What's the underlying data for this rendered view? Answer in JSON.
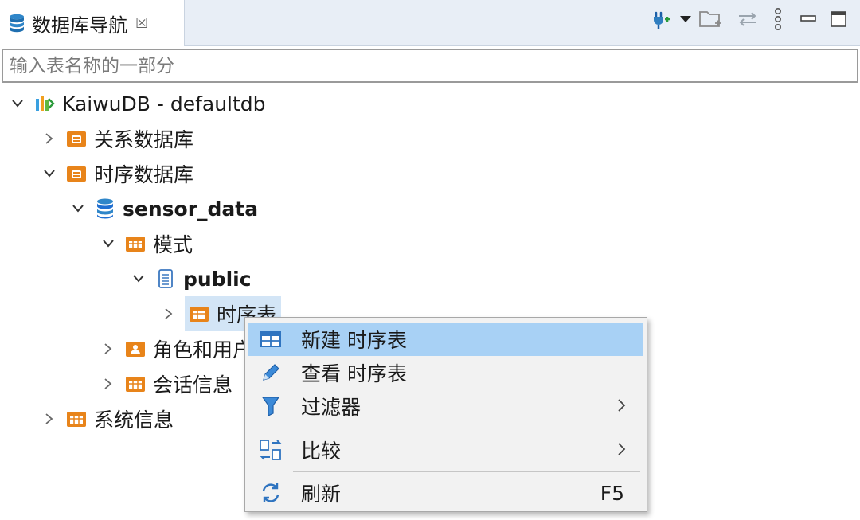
{
  "tab": {
    "title": "数据库导航",
    "close_symbol": "☒"
  },
  "toolbar": {
    "items": [
      "connect-icon",
      "dropdown-arrow-icon",
      "new-folder-icon",
      "link-editor-icon",
      "view-menu-icon",
      "minimize-icon",
      "maximize-icon"
    ]
  },
  "filter": {
    "placeholder": "输入表名称的一部分",
    "value": ""
  },
  "tree": {
    "connection": "KaiwuDB - defaultdb",
    "relational": "关系数据库",
    "timeseries": "时序数据库",
    "database": "sensor_data",
    "schemas": "模式",
    "schema_public": "public",
    "ts_tables": "时序表",
    "roles": "角色和用户",
    "sessions": "会话信息",
    "system_info": "系统信息"
  },
  "context_menu": {
    "items": [
      {
        "label": "新建 时序表",
        "icon": "table-icon",
        "highlighted": true
      },
      {
        "label": "查看 时序表",
        "icon": "pencil-icon"
      },
      {
        "label": "过滤器",
        "icon": "filter-icon",
        "submenu": true
      },
      {
        "label": "比较",
        "icon": "compare-icon",
        "submenu": true
      },
      {
        "label": "刷新",
        "icon": "refresh-icon",
        "shortcut": "F5"
      }
    ]
  },
  "colors": {
    "folder_orange": "#e8841a",
    "db_blue": "#1f6fd1",
    "selection": "#d3e5f6",
    "menu_highlight": "#a8d1f5"
  }
}
